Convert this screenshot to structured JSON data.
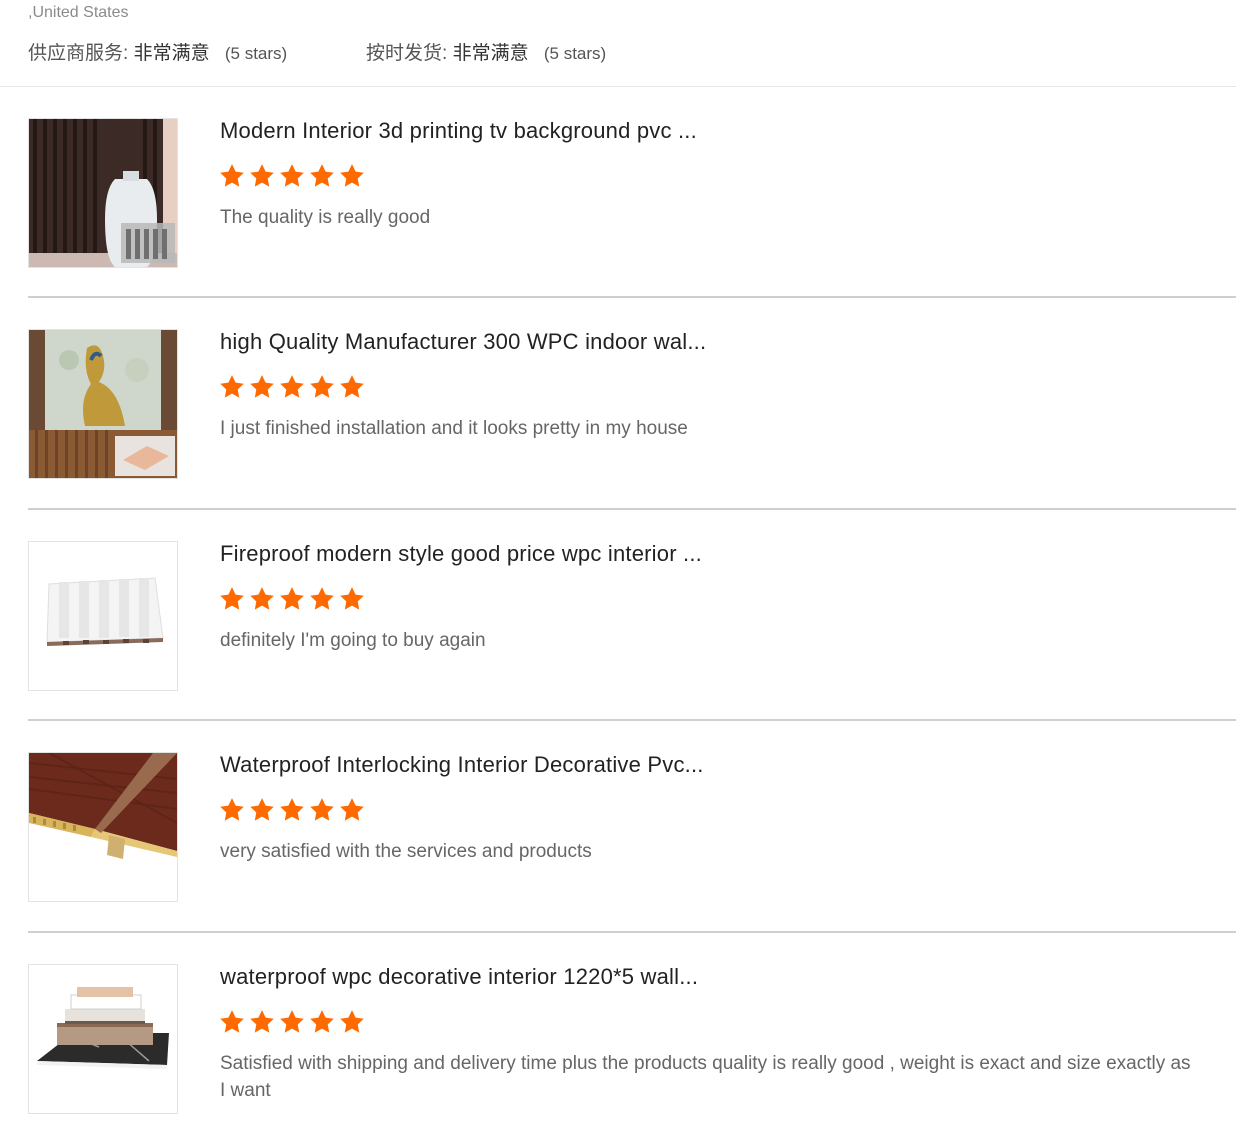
{
  "location": ",United States",
  "supplier_ratings": [
    {
      "label": "供应商服务:",
      "value": "非常满意",
      "stars_text": "(5 stars)"
    },
    {
      "label": "按时发货:",
      "value": "非常满意",
      "stars_text": "(5 stars)"
    }
  ],
  "star_color": "#ff6a00",
  "reviews": [
    {
      "title": "Modern Interior 3d printing tv background pvc ...",
      "rating": 5,
      "text": "The quality is really good",
      "thumb_icon": "product-photo-dark-wall-panel-vase"
    },
    {
      "title": "high Quality Manufacturer 300 WPC indoor wal...",
      "rating": 5,
      "text": "I just finished installation and it looks pretty in my house",
      "thumb_icon": "product-photo-peacock-wall"
    },
    {
      "title": "Fireproof modern style good price wpc interior ...",
      "rating": 5,
      "text": "definitely I'm going to buy again",
      "thumb_icon": "product-photo-white-fluted-panel"
    },
    {
      "title": "Waterproof Interlocking Interior Decorative Pvc...",
      "rating": 5,
      "text": "very satisfied with the services and products",
      "thumb_icon": "product-photo-wood-grain-panel"
    },
    {
      "title": "waterproof wpc decorative interior 1220*5 wall...",
      "rating": 5,
      "text": "Satisfied with shipping and delivery time plus the products quality is really good , weight is exact and size exactly as I want",
      "thumb_icon": "product-photo-stacked-boards"
    }
  ]
}
